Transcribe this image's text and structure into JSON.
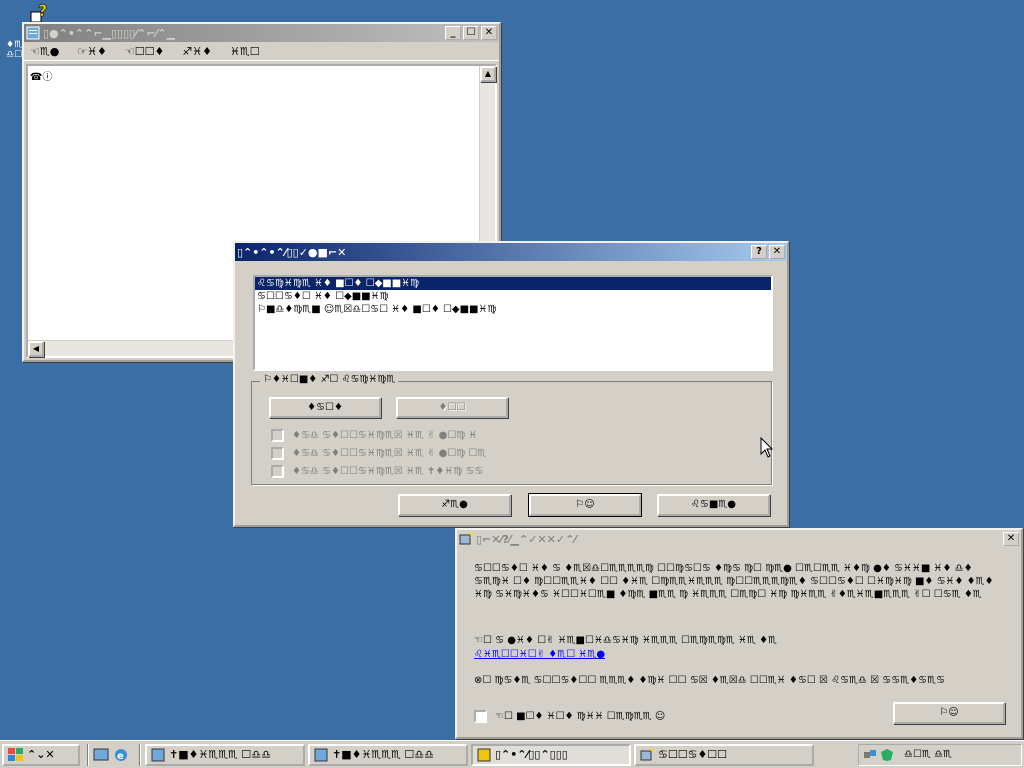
{
  "desktop": {
    "icon_label_1": "♦♏",
    "icon_label_2": "♎☐"
  },
  "notepad": {
    "title": "▯●⌃•⌃⌃⌐▁▯▯▯▯⁄⌃⌐⁄⌃▁",
    "menu": [
      "☜♏●",
      "☞♓♦",
      "☜☐☐♦",
      "♐♓♦",
      "♓♏☐"
    ],
    "content": "☎ⓘ",
    "controls": {
      "minimize": "_",
      "maximize": "☐",
      "close": "✕"
    }
  },
  "dialog": {
    "title": "▯⌃•⌃•⌃⁄▯▯✓●■⌐✕",
    "help": "?",
    "close": "✕",
    "list_items": [
      "♌♋♍♓♍♏ ♓♦ ■☐♦ ☐◆■■♓♍",
      "♋☐☐♋♦☐ ♓♦ ☐◆■■♓♍",
      "⚐■♎♦♍♏■ ☺♏☒♎☐♋☐ ♓♦ ■☐♦ ☐◆■■♓♍"
    ],
    "group_label": "⚐♦♓☐■♦ ♐☐ ♌♋♍♓♍♏",
    "btn_left": "♦♋☐♦",
    "btn_right": "♦☐☐",
    "options": [
      "♦♋♎ ♋♦☐☐♋♓♍♏☒ ♓♏ ✌ ●☐♍ ♓",
      "♦♋♎ ♋♦☐☐♋♓♍♏☒ ♓♏ ✌ ●☐♍ ☐♏",
      "♦♋♎ ♋♦☐☐♋♓♍♏☒ ♓♏ ✝♦♓♍ ♋♋"
    ],
    "footer_buttons": [
      "♐♏●",
      "⚐☺",
      "♌♋■♏●"
    ]
  },
  "info": {
    "title": "▯⌐✕⁄?⁄▁⌃✓✕✕✓⌃⁄",
    "close": "✕",
    "para1": "♋☐☐♋♦☐ ♓♦ ♋ ♦♏☒♎☐♏♏♏♏♍ ☐☐♍♋☐♋ ♦♍♋ ♍☐ ♍♏● ☐♏☐♏♏ ♓♦♍ ●♦ ♋♓♓■ ♓♦ ♎♦ ♋♏♍♓ ☐♦ ♍☐☐♏♏♓♦ ☐☐ ♦♓♏ ☐♍♏♏♓♏♏♏ ♍☐☐♏♏♏♍♏♦ ♋☐☐♋♦☐ ☐♓♍♓♍ ■♦ ♋♓♦ ♦♏♦ ♓♍ ♋♓♍♓♦♋ ♓☐☐♓☐♏■ ♦♍♏ ■♏♏ ♍ ♓♏♏♏ ☐♏♍☐ ♓♍ ♍♓♏♏ ✌♦♏♓♏■♏♏♏ ✌☐ ☐♋♏ ♦♏",
    "para2": "☜☐ ♋ ●♓♦ ☐✌ ♓♏■☐♓♎♋♓♍ ♓♏♏♏ ☐♏♍♏♍♏ ♓♏ ♦♏",
    "link": "♌♓♏☐☐♓☐✌ ♦♏☐ ♓♏●",
    "para3": "⊗☐ ♍♋♦♏ ♋☐☐♋♦☐☐ ♏♏♏♦ ♦♍♓ ☐☐ ♋☒ ♦♏☒♎ ☐☐♏♓ ♦♋☐ ☒ ♌♋♏♎ ☒ ♋♋♏♦♋♏♋",
    "checkbox_label": "☜☐ ■☐♦ ♓☐♦ ♍♓♓ ☐♏♍♏♏ ☺",
    "ok": "⚐☺"
  },
  "taskbar": {
    "start": "⌃⌄✕",
    "items": [
      {
        "label": "✝■♦♓♏♏♏ ☐♎♎",
        "active": false
      },
      {
        "label": "✝■♦♓♏♏♏ ☐♎♎",
        "active": false
      },
      {
        "label": "▯⌃•⌃⁄▯▯⌃▯▯▯",
        "active": true
      },
      {
        "label": "♋☐☐♋♦☐☐",
        "active": false
      }
    ],
    "tray_text": "♎☐♏ ♎♏"
  }
}
